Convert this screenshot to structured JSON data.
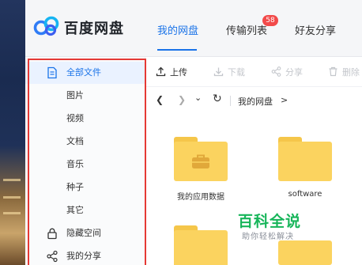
{
  "app": {
    "brand": "百度网盘"
  },
  "nav": {
    "tabs": [
      {
        "label": "我的网盘",
        "active": true
      },
      {
        "label": "传输列表",
        "active": false
      },
      {
        "label": "好友分享",
        "active": false
      }
    ],
    "transfer_badge": "58"
  },
  "sidebar": {
    "items": [
      {
        "label": "全部文件",
        "icon": "file-icon",
        "active": true
      },
      {
        "label": "图片",
        "icon": "",
        "active": false
      },
      {
        "label": "视频",
        "icon": "",
        "active": false
      },
      {
        "label": "文档",
        "icon": "",
        "active": false
      },
      {
        "label": "音乐",
        "icon": "",
        "active": false
      },
      {
        "label": "种子",
        "icon": "",
        "active": false
      },
      {
        "label": "其它",
        "icon": "",
        "active": false
      },
      {
        "label": "隐藏空间",
        "icon": "lock-icon",
        "active": false
      },
      {
        "label": "我的分享",
        "icon": "share-icon",
        "active": false
      }
    ],
    "highlight_color": "#e53935"
  },
  "toolbar": {
    "upload": "上传",
    "download": "下载",
    "share": "分享",
    "delete": "删除"
  },
  "pathbar": {
    "current": "我的网盘",
    "separator": ">"
  },
  "folders": [
    {
      "name": "我的应用数据",
      "icon": "briefcase-icon"
    },
    {
      "name": "software",
      "icon": ""
    },
    {
      "name": "",
      "icon": ""
    },
    {
      "name": "",
      "icon": ""
    }
  ],
  "watermark": {
    "title": "百科全说",
    "subtitle": "助你轻松解决"
  },
  "colors": {
    "accent": "#1a73e8",
    "folder": "#fbd35f",
    "badge": "#f24a4a",
    "watermark": "#17b55a"
  }
}
